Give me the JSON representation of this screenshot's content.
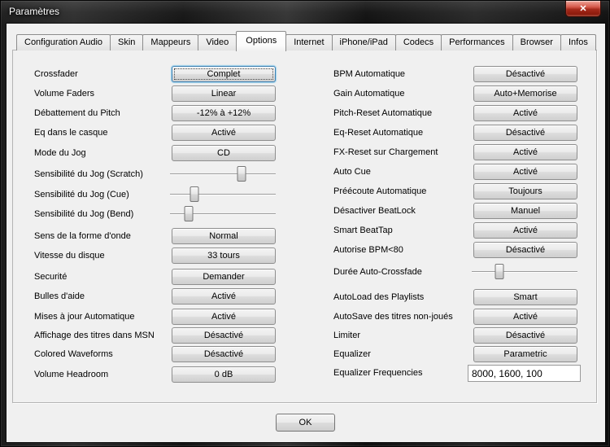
{
  "window": {
    "title": "Paramètres",
    "close_icon": "✕"
  },
  "colors": {
    "focus_blue": "#3c7fb1",
    "close_red": "#a62a1b",
    "dialog_bg": "#f0f0f0"
  },
  "tabs": [
    "Configuration Audio",
    "Skin",
    "Mappeurs",
    "Video",
    "Options",
    "Internet",
    "iPhone/iPad",
    "Codecs",
    "Performances",
    "Browser",
    "Infos"
  ],
  "selected_tab": "Options",
  "settings_left": [
    {
      "label": "Crossfader",
      "type": "button",
      "value": "Complet",
      "focused": true
    },
    {
      "label": "Volume Faders",
      "type": "button",
      "value": "Linear"
    },
    {
      "label": "Débattement du Pitch",
      "type": "button",
      "value": "-12% à +12%"
    },
    {
      "label": "Eq dans le casque",
      "type": "button",
      "value": "Activé"
    },
    {
      "label": "Mode du Jog",
      "type": "button",
      "value": "CD"
    },
    {
      "label": "Sensibilité du Jog (Scratch)",
      "type": "slider",
      "value_percent": 68
    },
    {
      "label": "Sensibilité du Jog (Cue)",
      "type": "slider",
      "value_percent": 23
    },
    {
      "label": "Sensibilité du Jog (Bend)",
      "type": "slider",
      "value_percent": 18
    },
    {
      "label": "Sens de la forme d'onde",
      "type": "button",
      "value": "Normal"
    },
    {
      "label": "Vitesse du disque",
      "type": "button",
      "value": "33 tours"
    },
    {
      "label": "Securité",
      "type": "button",
      "value": "Demander"
    },
    {
      "label": "Bulles d'aide",
      "type": "button",
      "value": "Activé"
    },
    {
      "label": "Mises à jour Automatique",
      "type": "button",
      "value": "Activé"
    },
    {
      "label": "Affichage des titres dans MSN",
      "type": "button",
      "value": "Désactivé"
    },
    {
      "label": "Colored Waveforms",
      "type": "button",
      "value": "Désactivé"
    },
    {
      "label": "Volume Headroom",
      "type": "button",
      "value": "0 dB"
    }
  ],
  "settings_right": [
    {
      "label": "BPM Automatique",
      "type": "button",
      "value": "Désactivé"
    },
    {
      "label": "Gain Automatique",
      "type": "button",
      "value": "Auto+Memorise"
    },
    {
      "label": "Pitch-Reset Automatique",
      "type": "button",
      "value": "Activé"
    },
    {
      "label": "Eq-Reset Automatique",
      "type": "button",
      "value": "Désactivé"
    },
    {
      "label": "FX-Reset sur Chargement",
      "type": "button",
      "value": "Activé"
    },
    {
      "label": "Auto Cue",
      "type": "button",
      "value": "Activé"
    },
    {
      "label": "Préécoute Automatique",
      "type": "button",
      "value": "Toujours"
    },
    {
      "label": "Désactiver BeatLock",
      "type": "button",
      "value": "Manuel"
    },
    {
      "label": "Smart BeatTap",
      "type": "button",
      "value": "Activé"
    },
    {
      "label": "Autorise BPM<80",
      "type": "button",
      "value": "Désactivé"
    },
    {
      "label": "Durée Auto-Crossfade",
      "type": "slider",
      "value_percent": 26
    },
    {
      "label": "AutoLoad des Playlists",
      "type": "button",
      "value": "Smart"
    },
    {
      "label": "AutoSave des titres non-joués",
      "type": "button",
      "value": "Activé"
    },
    {
      "label": "Limiter",
      "type": "button",
      "value": "Désactivé"
    },
    {
      "label": "Equalizer",
      "type": "button",
      "value": "Parametric"
    },
    {
      "label": "Equalizer Frequencies",
      "type": "input",
      "value": "8000, 1600, 100"
    }
  ],
  "footer": {
    "ok_label": "OK"
  }
}
